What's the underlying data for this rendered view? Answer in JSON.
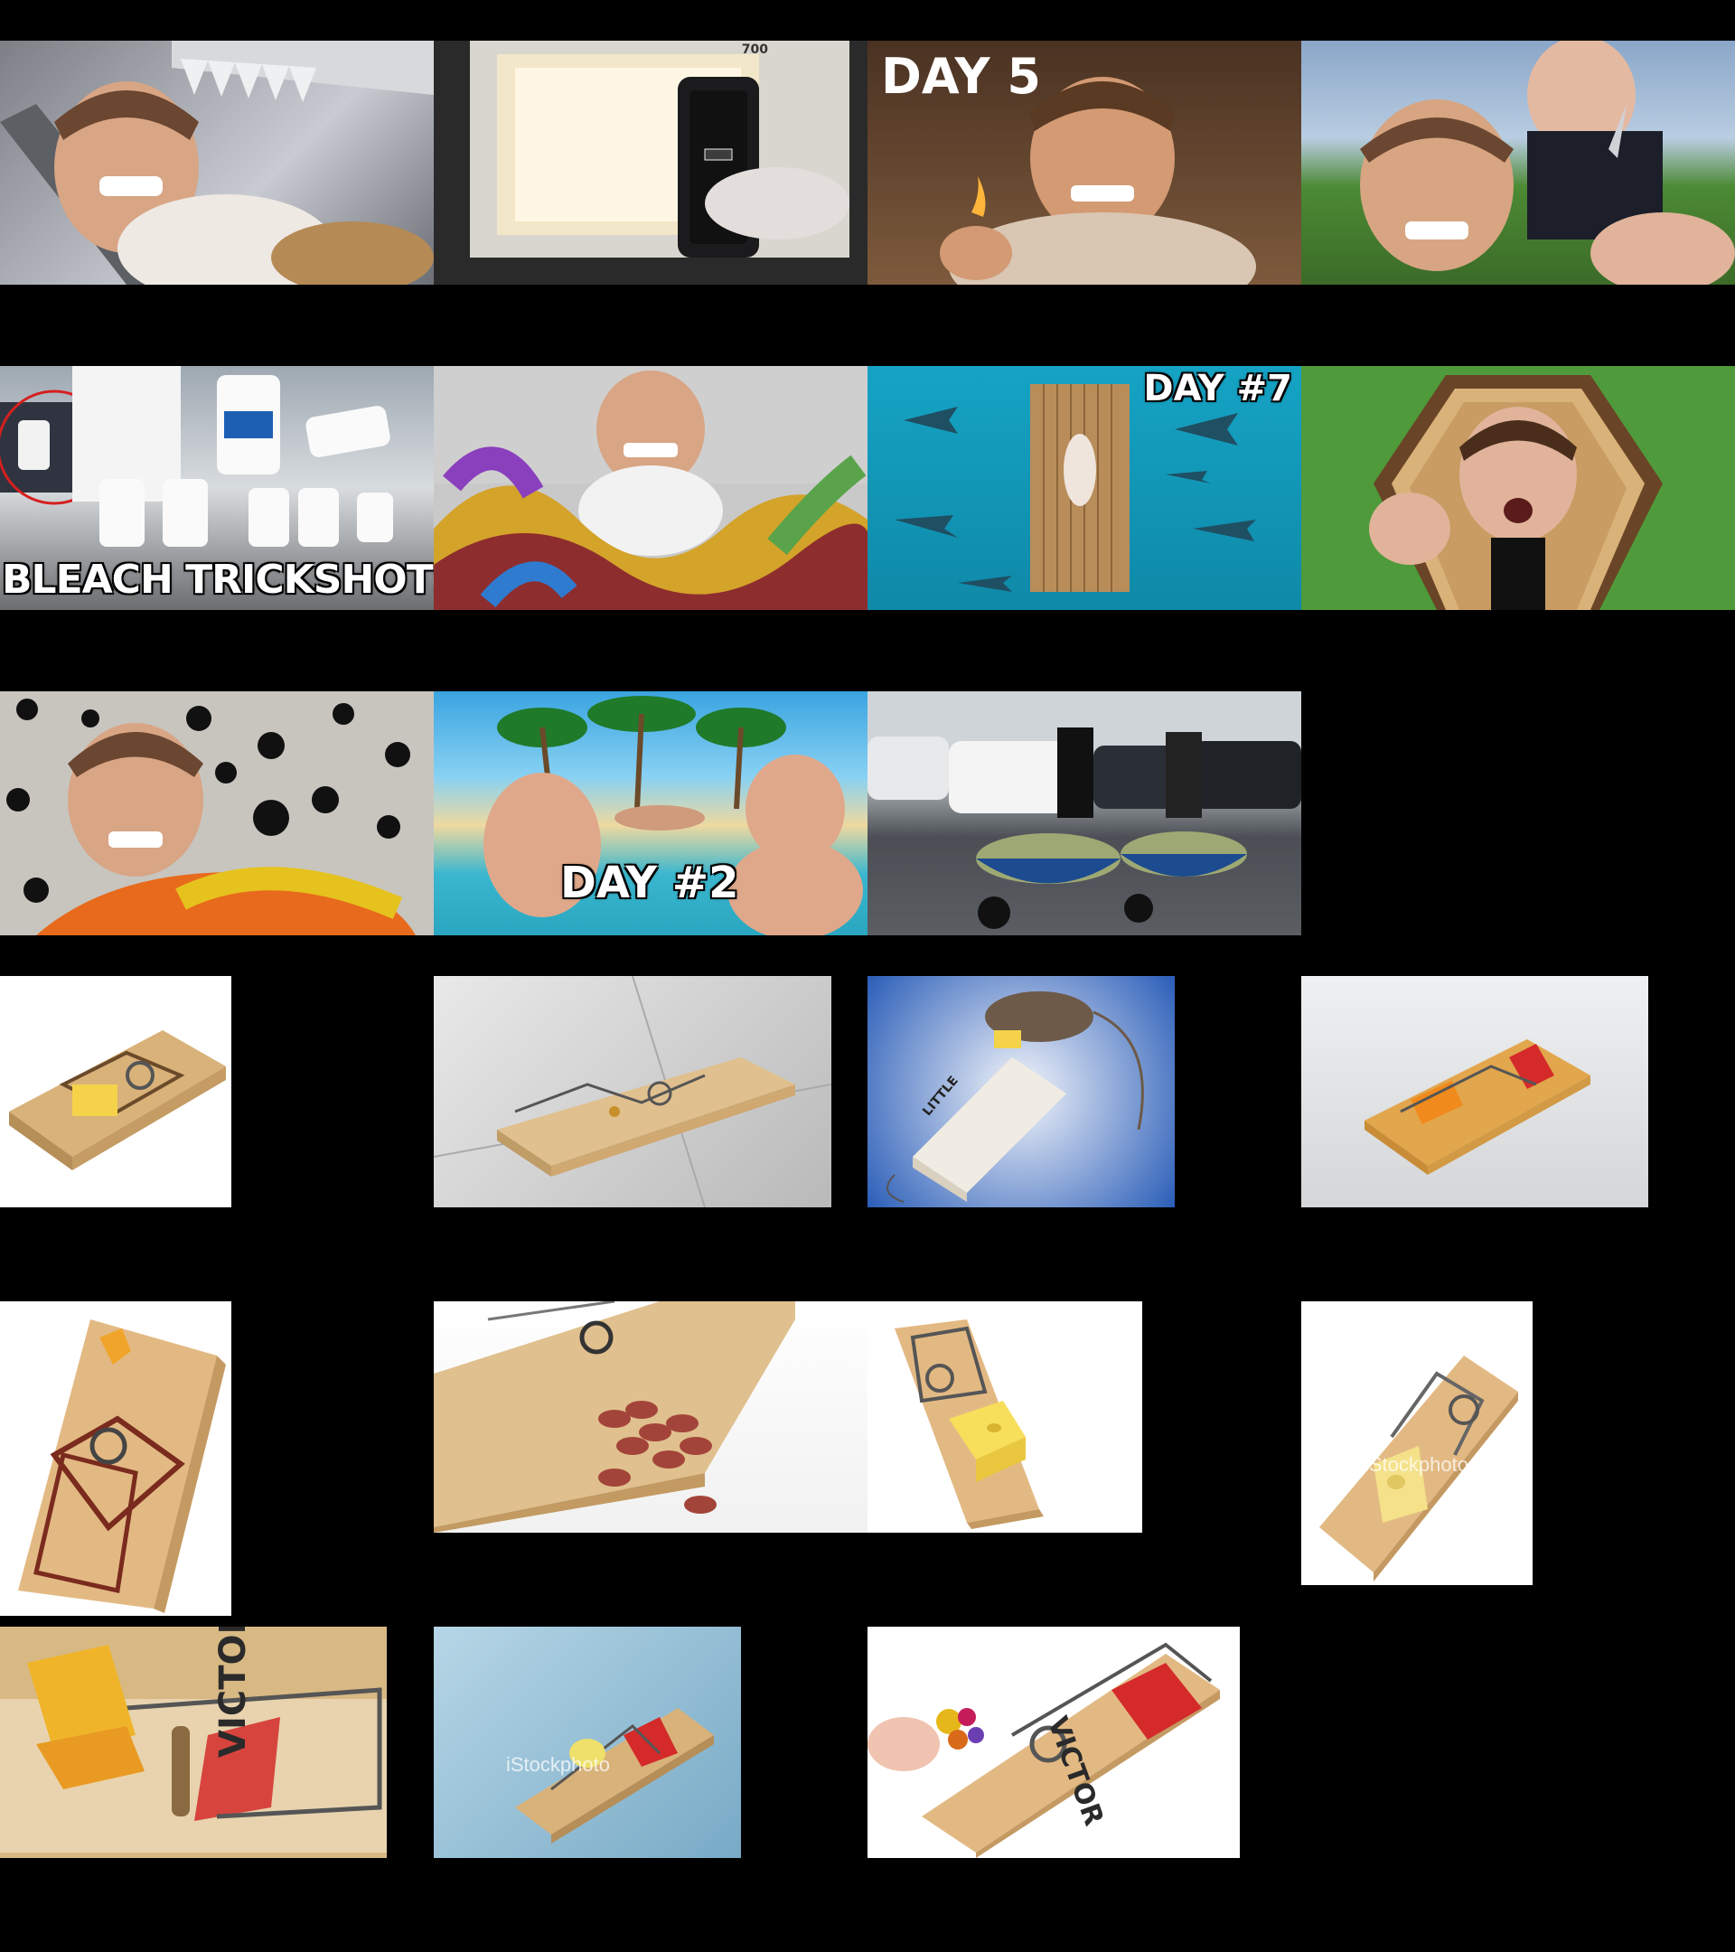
{
  "thumbnails": {
    "day5": "DAY 5",
    "bleach": "BLEACH TRICKSHOTS",
    "day7": "DAY #7",
    "day2": "DAY #2",
    "microwave_watts": "700"
  },
  "trap_labels": {
    "victor": "VICTOR",
    "little": "LITTLE",
    "istock": "iStockphoto"
  },
  "colors": {
    "background": "#000000",
    "victor_red": "#d42a2a",
    "wood": "#d9b27a"
  }
}
